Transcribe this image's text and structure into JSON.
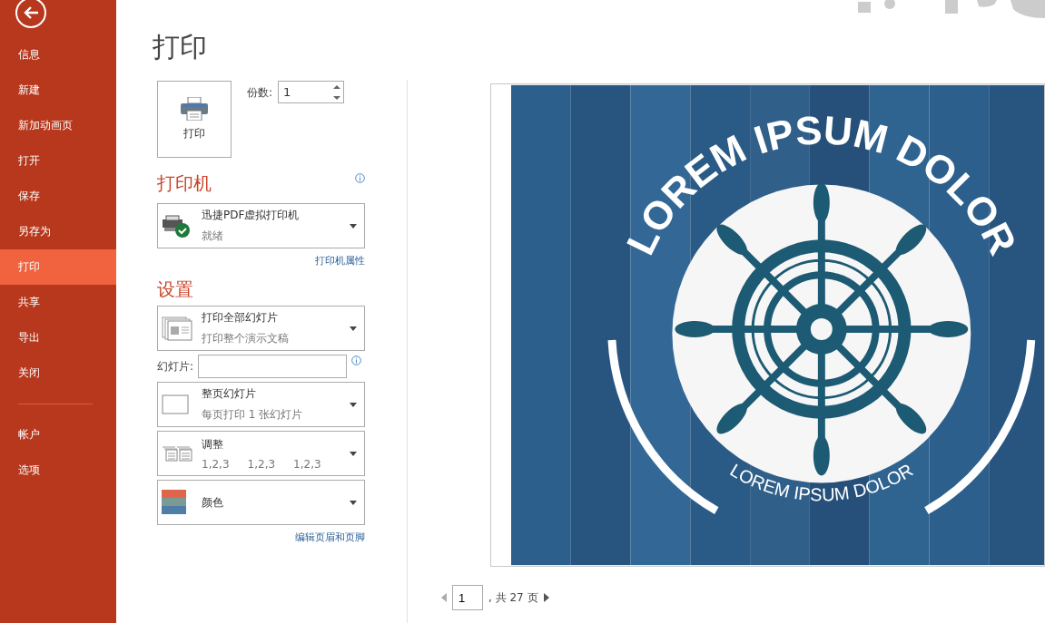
{
  "sidebar": {
    "items": [
      {
        "label": "信息",
        "selected": false
      },
      {
        "label": "新建",
        "selected": false
      },
      {
        "label": "新加动画页",
        "selected": false
      },
      {
        "label": "打开",
        "selected": false
      },
      {
        "label": "保存",
        "selected": false
      },
      {
        "label": "另存为",
        "selected": false
      },
      {
        "label": "打印",
        "selected": true
      },
      {
        "label": "共享",
        "selected": false
      },
      {
        "label": "导出",
        "selected": false
      },
      {
        "label": "关闭",
        "selected": false
      }
    ],
    "footer_items": [
      {
        "label": "帐户",
        "selected": false
      },
      {
        "label": "选项",
        "selected": false
      }
    ]
  },
  "title": "打印",
  "print_button": {
    "label": "打印"
  },
  "copies": {
    "label": "份数:",
    "value": "1"
  },
  "printer_section": {
    "heading": "打印机",
    "name": "迅捷PDF虚拟打印机",
    "status": "就绪",
    "link": "打印机属性"
  },
  "settings_section": {
    "heading": "设置",
    "dropdowns_top": [
      {
        "kind": "pages",
        "title": "打印全部幻灯片",
        "subtitle": "打印整个演示文稿"
      }
    ],
    "slides_field": {
      "label": "幻灯片:"
    },
    "dropdowns": [
      {
        "kind": "layout",
        "title": "整页幻灯片",
        "subtitle": "每页打印 1 张幻灯片"
      },
      {
        "kind": "collate",
        "title": "调整",
        "subtitle_parts": [
          "1,2,3",
          "1,2,3",
          "1,2,3"
        ]
      },
      {
        "kind": "color",
        "title": "颜色"
      }
    ],
    "link": "编辑页眉和页脚"
  },
  "preview": {
    "slide": {
      "headline": "LOREM IPSUM DOLOR",
      "caption": "LOREM IPSUM DOLOR"
    },
    "pager": {
      "page": "1",
      "total": ", 共 27 页"
    }
  }
}
